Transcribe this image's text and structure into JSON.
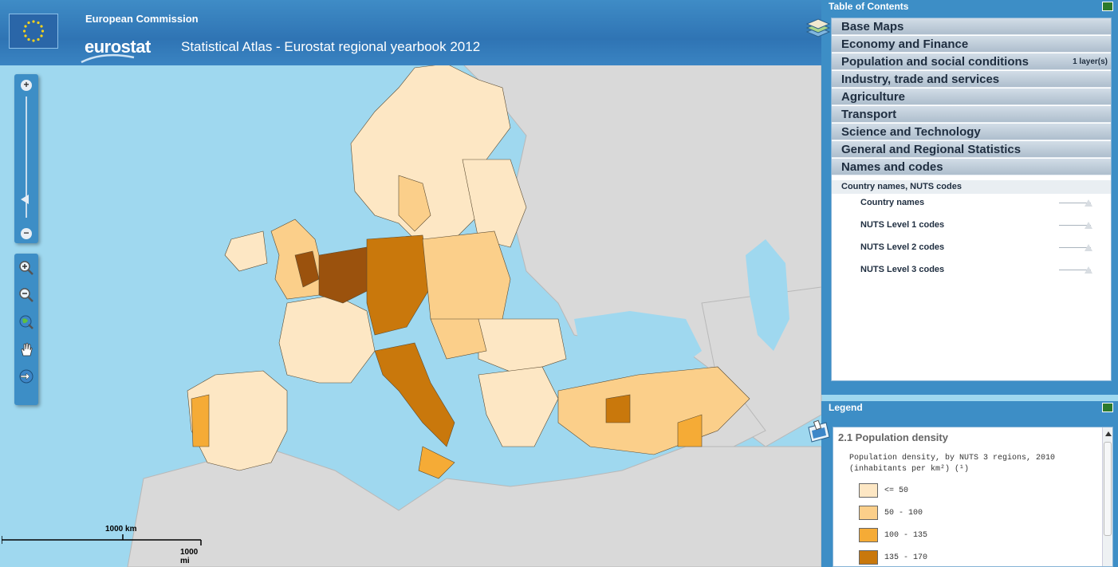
{
  "header": {
    "org": "European Commission",
    "brand": "eurostat",
    "title": "Statistical Atlas - Eurostat regional yearbook 2012"
  },
  "zoom": {
    "in_icon": "plus-icon",
    "out_icon": "minus-icon",
    "zoom_in_label": "+",
    "zoom_out_label": "−",
    "level_fraction": 0.65
  },
  "nav_tools": [
    {
      "name": "zoom-in-tool-icon"
    },
    {
      "name": "zoom-out-tool-icon"
    },
    {
      "name": "full-extent-globe-icon"
    },
    {
      "name": "pan-hand-icon"
    },
    {
      "name": "previous-extent-icon"
    }
  ],
  "toc": {
    "title": "Table of Contents",
    "categories": [
      {
        "label": "Base Maps",
        "badge": ""
      },
      {
        "label": "Economy and Finance",
        "badge": ""
      },
      {
        "label": "Population and social conditions",
        "badge": "1 layer(s)"
      },
      {
        "label": "Industry, trade and services",
        "badge": ""
      },
      {
        "label": "Agriculture",
        "badge": ""
      },
      {
        "label": "Transport",
        "badge": ""
      },
      {
        "label": "Science and Technology",
        "badge": ""
      },
      {
        "label": "General and Regional Statistics",
        "badge": ""
      },
      {
        "label": "Names and codes",
        "badge": ""
      }
    ],
    "subgroup": "Country names, NUTS codes",
    "layers": [
      {
        "label": "Country names"
      },
      {
        "label": "NUTS Level 1 codes"
      },
      {
        "label": "NUTS Level 2 codes"
      },
      {
        "label": "NUTS Level 3 codes"
      }
    ]
  },
  "legend": {
    "title": "Legend",
    "layer_title": "2.1 Population density",
    "description": "Population density, by NUTS 3 regions, 2010 (inhabitants per km²) (¹)",
    "classes": [
      {
        "label": "<= 50",
        "color": "#fde7c4"
      },
      {
        "label": "50 - 100",
        "color": "#fbcf8a"
      },
      {
        "label": "100 - 135",
        "color": "#f5ab36"
      },
      {
        "label": "135 - 170",
        "color": "#c9780c"
      }
    ]
  },
  "scale": {
    "km_label": "1000 km",
    "mi_label": "1000 mi"
  },
  "colors": {
    "sea": "#9fd8ef",
    "non_eu_land": "#d9d9d9",
    "panel_blue": "#3d8ec6",
    "dark": "#7a3f0c"
  }
}
